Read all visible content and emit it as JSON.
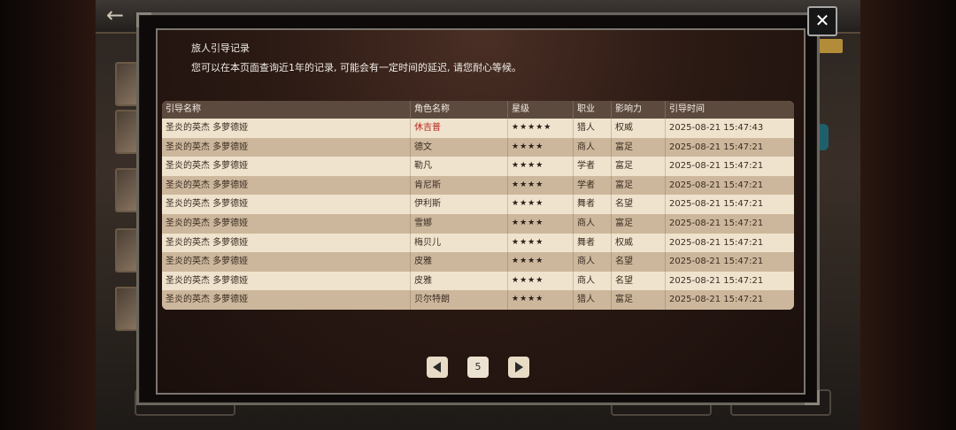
{
  "dialog": {
    "title": "旅人引导记录",
    "description": "您可以在本页面查询近1年的记录, 可能会有一定时间的延迟, 请您耐心等候。",
    "close_label": "✕"
  },
  "table": {
    "columns": [
      "引导名称",
      "角色名称",
      "星级",
      "职业",
      "影响力",
      "引导时间"
    ],
    "rows": [
      {
        "guide": "圣炎的英杰 多萝德娅",
        "character": "休吉普",
        "stars": "★★★★★",
        "job": "猎人",
        "influence": "权威",
        "time": "2025-08-21 15:47:43",
        "highlight": true
      },
      {
        "guide": "圣炎的英杰 多萝德娅",
        "character": "德文",
        "stars": "★★★★",
        "job": "商人",
        "influence": "富足",
        "time": "2025-08-21 15:47:21",
        "highlight": false
      },
      {
        "guide": "圣炎的英杰 多萝德娅",
        "character": "勒凡",
        "stars": "★★★★",
        "job": "学者",
        "influence": "富足",
        "time": "2025-08-21 15:47:21",
        "highlight": false
      },
      {
        "guide": "圣炎的英杰 多萝德娅",
        "character": "肯尼斯",
        "stars": "★★★★",
        "job": "学者",
        "influence": "富足",
        "time": "2025-08-21 15:47:21",
        "highlight": false
      },
      {
        "guide": "圣炎的英杰 多萝德娅",
        "character": "伊利斯",
        "stars": "★★★★",
        "job": "舞者",
        "influence": "名望",
        "time": "2025-08-21 15:47:21",
        "highlight": false
      },
      {
        "guide": "圣炎的英杰 多萝德娅",
        "character": "雪娜",
        "stars": "★★★★",
        "job": "商人",
        "influence": "富足",
        "time": "2025-08-21 15:47:21",
        "highlight": false
      },
      {
        "guide": "圣炎的英杰 多萝德娅",
        "character": "梅贝儿",
        "stars": "★★★★",
        "job": "舞者",
        "influence": "权威",
        "time": "2025-08-21 15:47:21",
        "highlight": false
      },
      {
        "guide": "圣炎的英杰 多萝德娅",
        "character": "皮雅",
        "stars": "★★★★",
        "job": "商人",
        "influence": "名望",
        "time": "2025-08-21 15:47:21",
        "highlight": false
      },
      {
        "guide": "圣炎的英杰 多萝德娅",
        "character": "皮雅",
        "stars": "★★★★",
        "job": "商人",
        "influence": "名望",
        "time": "2025-08-21 15:47:21",
        "highlight": false
      },
      {
        "guide": "圣炎的英杰 多萝德娅",
        "character": "贝尔特朗",
        "stars": "★★★★",
        "job": "猎人",
        "influence": "富足",
        "time": "2025-08-21 15:47:21",
        "highlight": false
      }
    ]
  },
  "pagination": {
    "current_page": "5"
  },
  "colors": {
    "highlight_text": "#b8231b",
    "header_bg": "#5d4a3e",
    "row_light": "#efe3cd",
    "row_dark": "#cdb79c"
  }
}
